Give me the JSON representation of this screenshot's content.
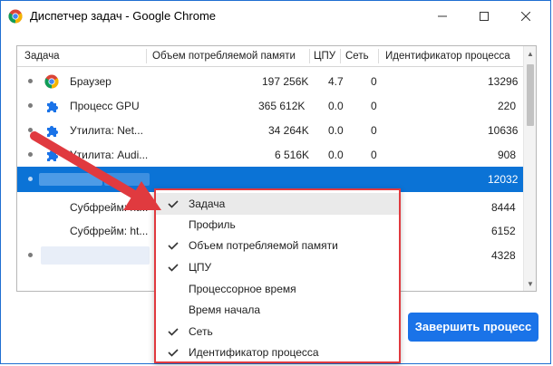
{
  "window": {
    "title": "Диспетчер задач - Google Chrome"
  },
  "table": {
    "headers": [
      "Задача",
      "Объем потребляемой памяти",
      "ЦПУ",
      "Сеть",
      "Идентификатор процесса"
    ],
    "rows": [
      {
        "name": "Браузер",
        "icon": "chrome-icon",
        "memory": "197 256K",
        "cpu": "4.7",
        "net": "0",
        "pid": "13296"
      },
      {
        "name": "Процесс GPU",
        "icon": "puzzle-icon",
        "memory": "365 612K",
        "cpu": "0.0",
        "net": "0",
        "pid": "220"
      },
      {
        "name": "Утилита: Net...",
        "icon": "puzzle-icon",
        "memory": "34 264K",
        "cpu": "0.0",
        "net": "0",
        "pid": "10636"
      },
      {
        "name": "Утилита: Audi...",
        "icon": "puzzle-icon",
        "memory": "6 516K",
        "cpu": "0.0",
        "net": "0",
        "pid": "908"
      },
      {
        "name": "",
        "icon": "",
        "memory": "",
        "cpu": "",
        "net": "",
        "pid": "12032"
      },
      {
        "name": "Субфрейм: ht...",
        "icon": "",
        "memory": "",
        "cpu": "",
        "net": "",
        "pid": "8444"
      },
      {
        "name": "Субфрейм: ht...",
        "icon": "",
        "memory": "",
        "cpu": "",
        "net": "",
        "pid": "6152"
      },
      {
        "name": "",
        "icon": "",
        "memory": "",
        "cpu": "",
        "net": "",
        "pid": "4328"
      }
    ]
  },
  "context_menu": {
    "items": [
      {
        "label": "Задача",
        "checked": true
      },
      {
        "label": "Профиль",
        "checked": false
      },
      {
        "label": "Объем потребляемой памяти",
        "checked": true
      },
      {
        "label": "ЦПУ",
        "checked": true
      },
      {
        "label": "Процессорное время",
        "checked": false
      },
      {
        "label": "Время начала",
        "checked": false
      },
      {
        "label": "Сеть",
        "checked": true
      },
      {
        "label": "Идентификатор процесса",
        "checked": true
      }
    ]
  },
  "buttons": {
    "end_process": "Завершить процесс"
  },
  "colors": {
    "accent": "#1a73e8",
    "selected_row": "#0b73d6",
    "highlight": "#e03a3f"
  }
}
